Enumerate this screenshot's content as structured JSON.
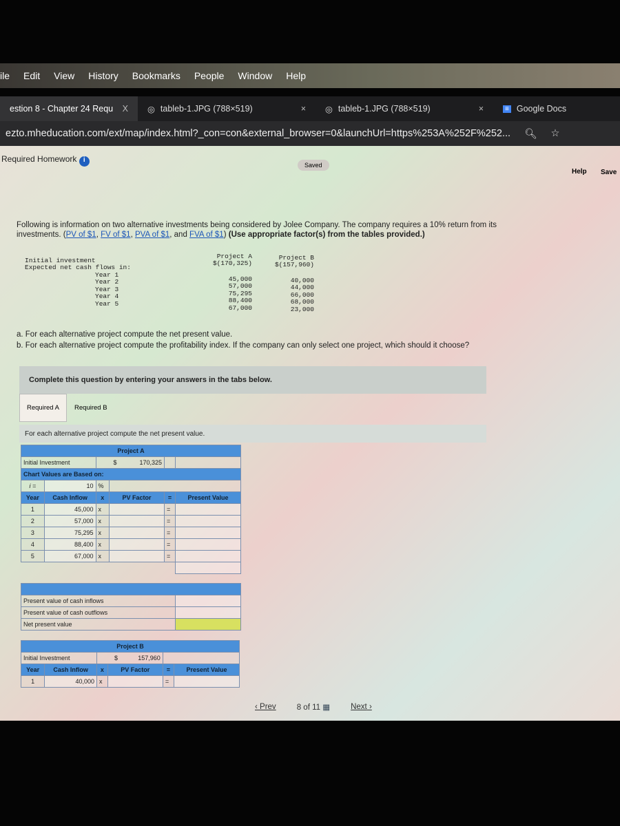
{
  "menu": [
    "ile",
    "Edit",
    "View",
    "History",
    "Bookmarks",
    "People",
    "Window",
    "Help"
  ],
  "tabs": [
    {
      "label": "estion 8 - Chapter 24 Requ",
      "close": "X"
    },
    {
      "label": "tableb-1.JPG (788×519)",
      "close": "×"
    },
    {
      "label": "tableb-1.JPG (788×519)",
      "close": "×"
    },
    {
      "label": "Google Docs"
    }
  ],
  "url": "ezto.mheducation.com/ext/map/index.html?_con=con&external_browser=0&launchUrl=https%253A%252F%252...",
  "header": {
    "title": "Required Homework",
    "saved": "Saved",
    "help": "Help",
    "save": "Save"
  },
  "intro": {
    "text": "Following is information on two alternative investments being considered by Jolee Company. The company requires a 10% return from its investments.",
    "links": [
      "PV of $1",
      "FV of $1",
      "PVA of $1",
      "FVA of $1"
    ],
    "note": "(Use appropriate factor(s) from the tables provided.)"
  },
  "given": {
    "labels": [
      "Initial investment",
      "Expected net cash flows in:",
      "Year 1",
      "Year 2",
      "Year 3",
      "Year 4",
      "Year 5"
    ],
    "project_a": {
      "name": "Project A",
      "initial": "$(170,325)",
      "flows": [
        "45,000",
        "57,000",
        "75,295",
        "88,400",
        "67,000"
      ]
    },
    "project_b": {
      "name": "Project B",
      "initial": "$(157,960)",
      "flows": [
        "40,000",
        "44,000",
        "66,000",
        "68,000",
        "23,000"
      ]
    }
  },
  "questions": [
    "a. For each alternative project compute the net present value.",
    "b. For each alternative project compute the profitability index. If the company can only select one project, which should it choose?"
  ],
  "banner": "Complete this question by entering your answers in the tabs below.",
  "req_tabs": [
    "Required A",
    "Required B"
  ],
  "instruction": "For each alternative project compute the net present value.",
  "table_a": {
    "title": "Project A",
    "initial_label": "Initial Investment",
    "dollar": "$",
    "initial": "170,325",
    "based_on": "Chart Values are Based on:",
    "i_label": "i =",
    "rate": "10",
    "pct": "%",
    "headers": [
      "Year",
      "Cash Inflow",
      "x",
      "PV Factor",
      "=",
      "Present Value"
    ],
    "rows": [
      {
        "year": "1",
        "inflow": "45,000"
      },
      {
        "year": "2",
        "inflow": "57,000"
      },
      {
        "year": "3",
        "inflow": "75,295"
      },
      {
        "year": "4",
        "inflow": "88,400"
      },
      {
        "year": "5",
        "inflow": "67,000"
      }
    ],
    "summary": [
      "Present value of cash inflows",
      "Present value of cash outflows",
      "Net present value"
    ]
  },
  "table_b": {
    "title": "Project B",
    "initial_label": "Initial Investment",
    "dollar": "$",
    "initial": "157,960",
    "headers": [
      "Year",
      "Cash Inflow",
      "x",
      "PV Factor",
      "=",
      "Present Value"
    ],
    "rows": [
      {
        "year": "1",
        "inflow": "40,000"
      }
    ]
  },
  "footer": {
    "prev": "Prev",
    "page": "8",
    "of": "of 11",
    "next": "Next"
  }
}
